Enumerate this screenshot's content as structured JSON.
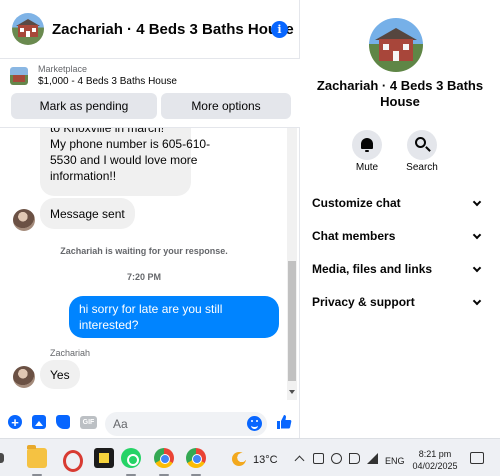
{
  "chat": {
    "title": "Zachariah · 4 Beds 3 Baths House",
    "listing": {
      "category": "Marketplace",
      "name": "$1,000 - 4 Beds 3 Baths House",
      "mark_pending_label": "Mark as pending",
      "more_options_label": "More options"
    },
    "messages": {
      "incoming_long_lines": [
        "to Knoxville in march!",
        "My phone number is 605-610-",
        "5530 and I would love more",
        "information!!"
      ],
      "message_sent": "Message sent",
      "waiting_note": "Zachariah is waiting for your response.",
      "timestamp": "7:20 PM",
      "outgoing": "hi sorry for late are you still interested?",
      "sender_name": "Zachariah",
      "incoming_last": "Yes"
    },
    "composer": {
      "placeholder": "Aa",
      "gif_label": "GIF"
    }
  },
  "details": {
    "title": "Zachariah · 4 Beds 3 Baths House",
    "actions": [
      {
        "label": "Mute",
        "icon": "bell-icon"
      },
      {
        "label": "Search",
        "icon": "search-icon"
      }
    ],
    "menu": [
      {
        "label": "Customize chat"
      },
      {
        "label": "Chat members"
      },
      {
        "label": "Media, files and links"
      },
      {
        "label": "Privacy & support"
      }
    ]
  },
  "taskbar": {
    "temperature": "13°C",
    "language": "ENG",
    "time": "8:21 pm",
    "date": "04/02/2025",
    "apps": [
      "file-explorer",
      "snipping-tool",
      "sticky-notes",
      "whatsapp",
      "chrome",
      "chrome"
    ]
  },
  "colors": {
    "accent": "#0866ff",
    "outgoing_bubble": "#0084ff",
    "incoming_bubble": "#f0f0f0",
    "button_bg": "#e4e6eb"
  }
}
